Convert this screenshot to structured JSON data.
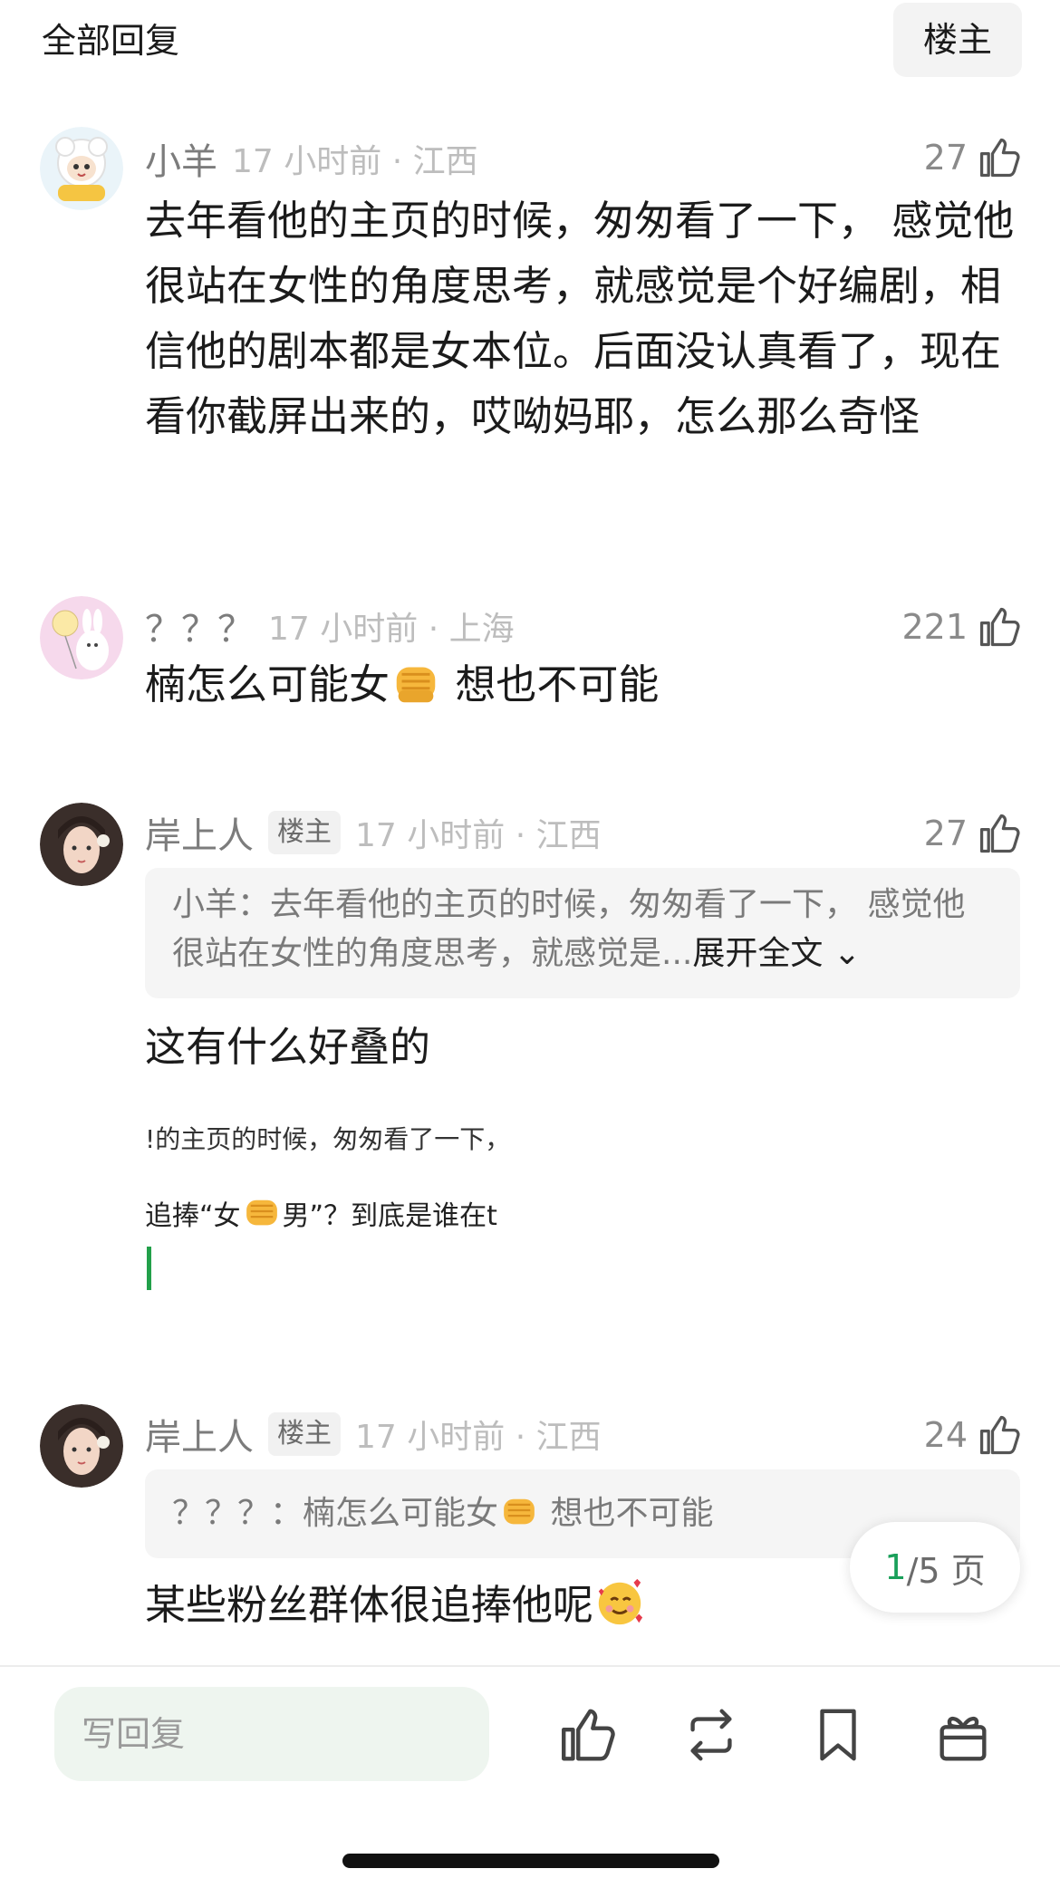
{
  "header": {
    "title": "全部回复",
    "op_button": "楼主"
  },
  "comments": [
    {
      "name": "小羊",
      "time": "17 小时前 · 江西",
      "likes": "27",
      "text": "去年看他的主页的时候，匆匆看了一下， 感觉他很站在女性的角度思考，就感觉是个好编剧，相信他的剧本都是女本位。后面没认真看了，现在看你截屏出来的，哎呦妈耶，怎么那么奇怪"
    },
    {
      "name": "？？？",
      "time": "17 小时前 · 上海",
      "likes": "221",
      "text_before": "楠怎么可能女",
      "text_after": " 想也不可能",
      "emoji": "fist-emoji"
    },
    {
      "name": "岸上人",
      "tag": "楼主",
      "time": "17 小时前 · 江西",
      "likes": "27",
      "quote_author": "小羊：",
      "quote_text": "去年看他的主页的时候，匆匆看了一下， 感觉他很站在女性的角度思考，就感觉是...",
      "quote_expand": "展开全文",
      "text": "这有什么好叠的",
      "pasted_line1": "!的主页的时候，匆匆看了一下，",
      "pasted_line2_before": "追捧“女",
      "pasted_line2_after": "男”？到底是谁在t"
    },
    {
      "name": "岸上人",
      "tag": "楼主",
      "time": "17 小时前 · 江西",
      "likes": "24",
      "quote_author": "？？？：",
      "quote_before": "楠怎么可能女",
      "quote_after": " 想也不可能",
      "text": "某些粉丝群体很追捧他呢",
      "emoji": "smiling-hearts-emoji"
    }
  ],
  "pagination": {
    "current": "1",
    "rest": "/5 页"
  },
  "bottom_bar": {
    "reply_placeholder": "写回复",
    "icons": [
      "thumbs-up-icon",
      "repost-icon",
      "bookmark-icon",
      "gift-icon"
    ]
  },
  "colors": {
    "accent": "#1aa05a",
    "meta_gray": "#bdbdbd",
    "name_gray": "#7c7c7c"
  }
}
